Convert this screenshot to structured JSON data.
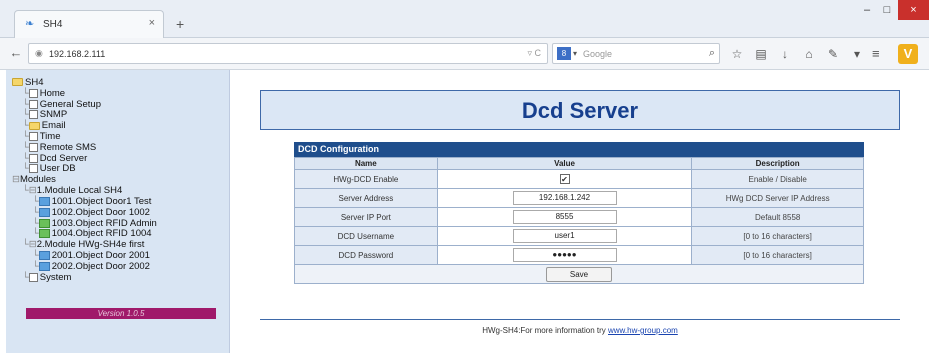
{
  "browser": {
    "tab_title": "SH4",
    "tab_close": "×",
    "new_tab": "+",
    "url": "192.168.2.111",
    "search_engine": "8",
    "search_placeholder": "Google",
    "window_min": "–",
    "window_max": "□",
    "window_close": "×"
  },
  "sidebar": {
    "tree": [
      {
        "label": "SH4",
        "indent": 0,
        "icon": "folder"
      },
      {
        "label": "Home",
        "indent": 1,
        "icon": "page"
      },
      {
        "label": "General Setup",
        "indent": 1,
        "icon": "page"
      },
      {
        "label": "SNMP",
        "indent": 1,
        "icon": "page"
      },
      {
        "label": "Email",
        "indent": 1,
        "icon": "folder"
      },
      {
        "label": "Time",
        "indent": 1,
        "icon": "page"
      },
      {
        "label": "Remote SMS",
        "indent": 1,
        "icon": "page"
      },
      {
        "label": "Dcd Server",
        "indent": 1,
        "icon": "page"
      },
      {
        "label": "User DB",
        "indent": 1,
        "icon": "page"
      },
      {
        "label": "Modules",
        "indent": 0,
        "icon": "none"
      },
      {
        "label": "1.Module Local SH4",
        "indent": 1,
        "icon": "none"
      },
      {
        "label": "1001.Object Door1 Test",
        "indent": 2,
        "icon": "obj"
      },
      {
        "label": "1002.Object Door 1002",
        "indent": 2,
        "icon": "obj"
      },
      {
        "label": "1003.Object RFID Admin",
        "indent": 2,
        "icon": "obj-green"
      },
      {
        "label": "1004.Object RFID 1004",
        "indent": 2,
        "icon": "obj-green"
      },
      {
        "label": "2.Module HWg-SH4e first",
        "indent": 1,
        "icon": "none"
      },
      {
        "label": "2001.Object Door 2001",
        "indent": 2,
        "icon": "obj"
      },
      {
        "label": "2002.Object Door 2002",
        "indent": 2,
        "icon": "obj"
      },
      {
        "label": "System",
        "indent": 1,
        "icon": "page"
      }
    ],
    "version": "Version 1.0.5"
  },
  "main": {
    "title": "Dcd Server",
    "config_header": "DCD Configuration",
    "columns": {
      "name": "Name",
      "value": "Value",
      "description": "Description"
    },
    "rows": [
      {
        "name": "HWg-DCD Enable",
        "type": "checkbox",
        "checked": "✔",
        "description": "Enable / Disable"
      },
      {
        "name": "Server Address",
        "type": "text",
        "value": "192.168.1.242",
        "description": "HWg DCD Server IP Address"
      },
      {
        "name": "Server IP Port",
        "type": "text",
        "value": "8555",
        "description": "Default 8558"
      },
      {
        "name": "DCD Username",
        "type": "text",
        "value": "user1",
        "description": "[0 to 16 characters]"
      },
      {
        "name": "DCD Password",
        "type": "text",
        "value": "●●●●●",
        "description": "[0 to 16 characters]"
      }
    ],
    "save_label": "Save",
    "footer_text": "HWg-SH4:For more information try ",
    "footer_link": "www.hw-group.com"
  }
}
